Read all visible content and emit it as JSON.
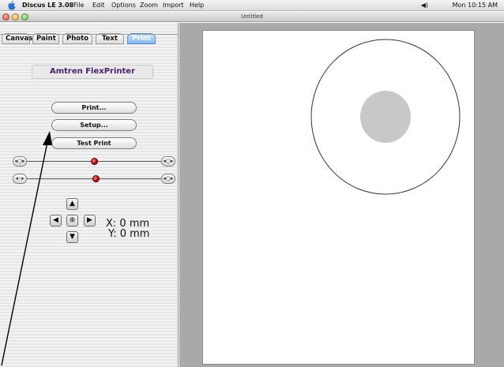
{
  "menubar": {
    "app": "Discus LE 3.08",
    "items": [
      "File",
      "Edit",
      "Options",
      "Zoom",
      "Import",
      "Help"
    ],
    "volume": "◀)",
    "clock": "Mon 10:15 AM"
  },
  "window": {
    "title": "Untitled"
  },
  "tabs": [
    "Canvas",
    "Paint",
    "Photo",
    "Text",
    "Print"
  ],
  "active_tab": "Print",
  "printer": {
    "name": "Amtren FlexPrinter"
  },
  "buttons": {
    "print": "Print...",
    "setup": "Setup...",
    "test_print": "Test Print"
  },
  "position": {
    "x": "X: 0 mm",
    "y": "Y: 0 mm"
  },
  "colors": {
    "tab_active": "#7fb6ef",
    "knob": "#c00000",
    "disc_hub": "#c8c8c8",
    "printer_label": "#4a1f6b"
  }
}
